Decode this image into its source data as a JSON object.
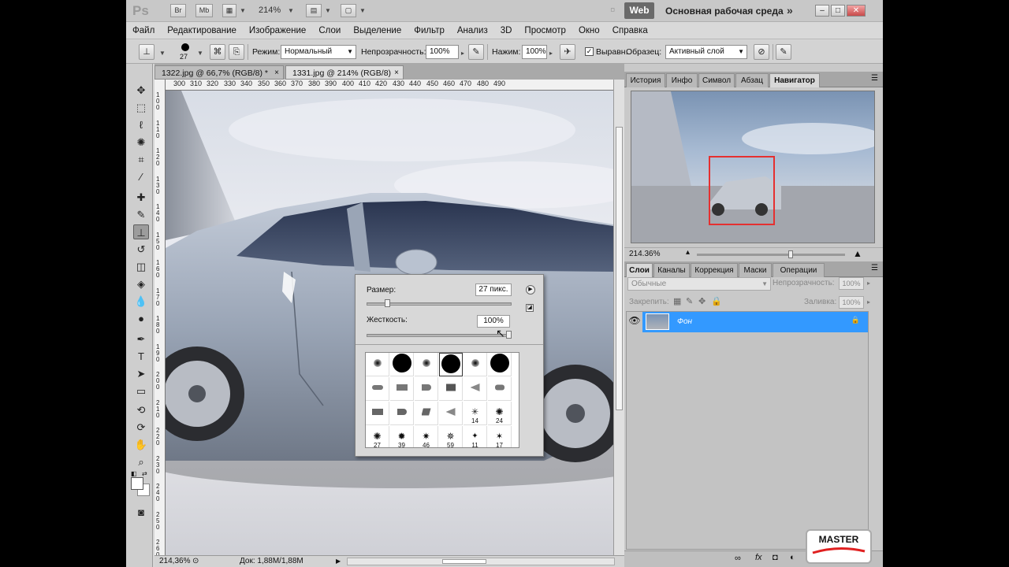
{
  "app": {
    "logo": "Ps",
    "bridge_btn": "Br",
    "minibridge_btn": "Mb",
    "zoom": "214%",
    "web_btn": "Web",
    "workspace": "Основная рабочая среда",
    "workspace_more": "»"
  },
  "menu": [
    "Файл",
    "Редактирование",
    "Изображение",
    "Слои",
    "Выделение",
    "Фильтр",
    "Анализ",
    "3D",
    "Просмотр",
    "Окно",
    "Справка"
  ],
  "options": {
    "brush_size": "27",
    "mode_label": "Режим:",
    "mode_value": "Нормальный",
    "opacity_label": "Непрозрачность:",
    "opacity_value": "100%",
    "flow_label": "Нажим:",
    "flow_value": "100%",
    "aligned_label": "Выравн.",
    "sample_label": "Образец:",
    "sample_value": "Активный слой"
  },
  "doc_tabs": [
    {
      "label": "1322.jpg @ 66,7% (RGB/8) *",
      "close": "×"
    },
    {
      "label": "1331.jpg @ 214% (RGB/8)",
      "close": "×"
    }
  ],
  "ruler_top": [
    "300",
    "310",
    "320",
    "330",
    "340",
    "350",
    "360",
    "370",
    "380",
    "390",
    "400",
    "410",
    "420",
    "430",
    "440",
    "450",
    "460",
    "470",
    "480",
    "490"
  ],
  "ruler_left": [
    "1 0 0",
    "1 1 0",
    "1 2 0",
    "1 3 0",
    "1 4 0",
    "1 5 0",
    "1 6 0",
    "1 7 0",
    "1 8 0",
    "1 9 0",
    "2 0 0",
    "2 1 0",
    "2 2 0",
    "2 3 0",
    "2 4 0",
    "2 5 0",
    "2 6 0"
  ],
  "status": {
    "zoom": "214,36%",
    "doc": "Док: 1,88M/1,88M"
  },
  "brush_popup": {
    "size_label": "Размер:",
    "size_value": "27 пикс.",
    "hardness_label": "Жесткость:",
    "hardness_value": "100%",
    "size_fraction": 0.13,
    "hardness_fraction": 1.0,
    "brush_numbers": [
      "14",
      "24",
      "27",
      "39",
      "46",
      "59",
      "11",
      "17"
    ]
  },
  "navigator": {
    "tabs": [
      "История",
      "Инфо",
      "Символ",
      "Абзац",
      "Навигатор"
    ],
    "zoom": "214.36%"
  },
  "layers": {
    "tabs": [
      "Слои",
      "Каналы",
      "Коррекция",
      "Маски",
      "Операции"
    ],
    "blend_mode": "Обычные",
    "opacity_label": "Непрозрачность:",
    "opacity_value": "100%",
    "lock_label": "Закрепить:",
    "fill_label": "Заливка:",
    "fill_value": "100%",
    "layer_name": "Фон"
  },
  "watermark": {
    "text": "MASTER"
  },
  "colors": {
    "selection_blue": "#3399ff",
    "nav_frame": "#e53030"
  }
}
